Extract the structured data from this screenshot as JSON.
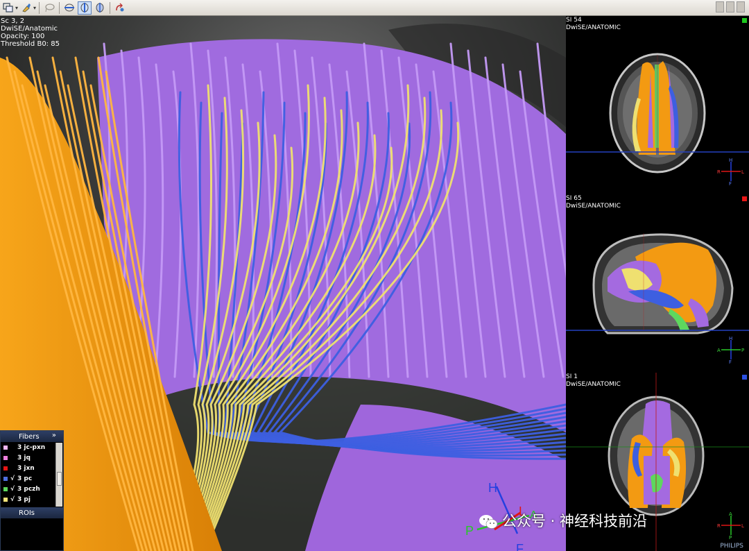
{
  "overlay": {
    "series": "Sc 3, 2",
    "contrast": "DwiSE/Anatomic",
    "opacity": "Opacity: 100",
    "threshold": "Threshold B0: 85"
  },
  "orientation_3d": {
    "up": "H",
    "down": "F",
    "left": "P",
    "right": "A",
    "red_axis": "L"
  },
  "fibers_panel": {
    "title": "Fibers",
    "collapse_glyph": "»",
    "items": [
      {
        "label": "3 jc-pxn",
        "color": "#f2b8f5",
        "checked": false
      },
      {
        "label": "3 jq",
        "color": "#ee7fdf",
        "checked": false
      },
      {
        "label": "3 jxn",
        "color": "#e81616",
        "checked": false
      },
      {
        "label": "3 pc",
        "color": "#4f6fe0",
        "checked": true
      },
      {
        "label": "3 pczh",
        "color": "#5ed85e",
        "checked": true
      },
      {
        "label": "3 pj",
        "color": "#f5e47a",
        "checked": true
      }
    ],
    "check_glyph": "√",
    "rois_title": "ROIs"
  },
  "views": [
    {
      "slice": "SI 54",
      "contrast": "DwiSE/ANATOMIC",
      "indicator": "#1ec71e",
      "orient": {
        "top": "H",
        "bottom": "F",
        "left": "R",
        "right": "L"
      }
    },
    {
      "slice": "SI 65",
      "contrast": "DwiSE/ANATOMIC",
      "indicator": "#e81616",
      "orient": {
        "top": "H",
        "bottom": "F",
        "left": "A",
        "right": "P"
      }
    },
    {
      "slice": "SI 1",
      "contrast": "DwiSE/ANATOMIC",
      "indicator": "#2a4fe0",
      "orient": {
        "top": "A",
        "bottom": "P",
        "left": "R",
        "right": "L"
      }
    }
  ],
  "vendor": "PHILIPS",
  "brand": "公众号 · 神经科技前沿",
  "colors": {
    "orange": "#f39a12",
    "purple": "#a46ae0",
    "blue": "#3d5fe0",
    "yellow": "#efe070",
    "green": "#56d456"
  }
}
